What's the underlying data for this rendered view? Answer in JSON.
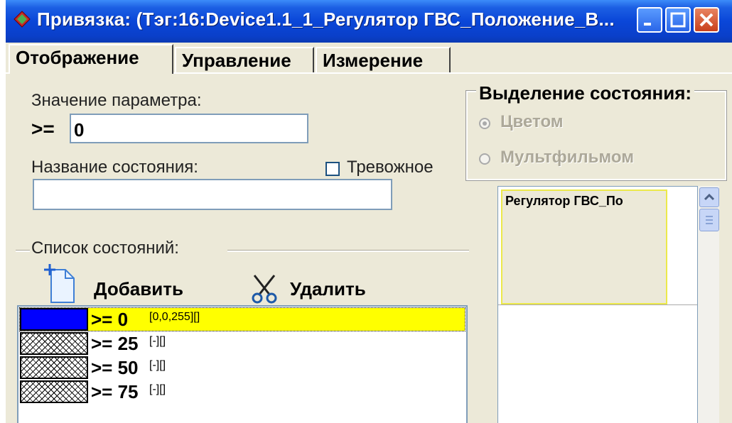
{
  "window": {
    "title": "Привязка: (Тэг:16:Device1.1_1_Регулятор ГВС_Положение_В..."
  },
  "tabs": [
    {
      "label": "Отображение"
    },
    {
      "label": "Управление"
    },
    {
      "label": "Измерение"
    }
  ],
  "param": {
    "label": "Значение параметра:",
    "operator": ">=",
    "value": "0"
  },
  "state_name": {
    "label": "Название состояния:",
    "value": "",
    "alarm_label": "Тревожное"
  },
  "highlight": {
    "title": "Выделение состояния:",
    "options": [
      "Цветом",
      "Мультфильмом"
    ],
    "selected": "Цветом"
  },
  "preview": {
    "text": "Регулятор ГВС_По"
  },
  "states": {
    "label": "Список состояний:",
    "add": "Добавить",
    "delete": "Удалить",
    "rows": [
      {
        "cond": ">= 0",
        "extra": "[0,0,255][]",
        "fill": "#0000FF",
        "selected": true
      },
      {
        "cond": ">= 25",
        "extra": "[-][]",
        "fill": "hatch",
        "selected": false
      },
      {
        "cond": ">= 50",
        "extra": "[-][]",
        "fill": "hatch",
        "selected": false
      },
      {
        "cond": ">= 75",
        "extra": "[-][]",
        "fill": "hatch",
        "selected": false
      }
    ]
  },
  "colors": {
    "selection": "#FFFF00",
    "titlebar": "#0A46D8"
  }
}
